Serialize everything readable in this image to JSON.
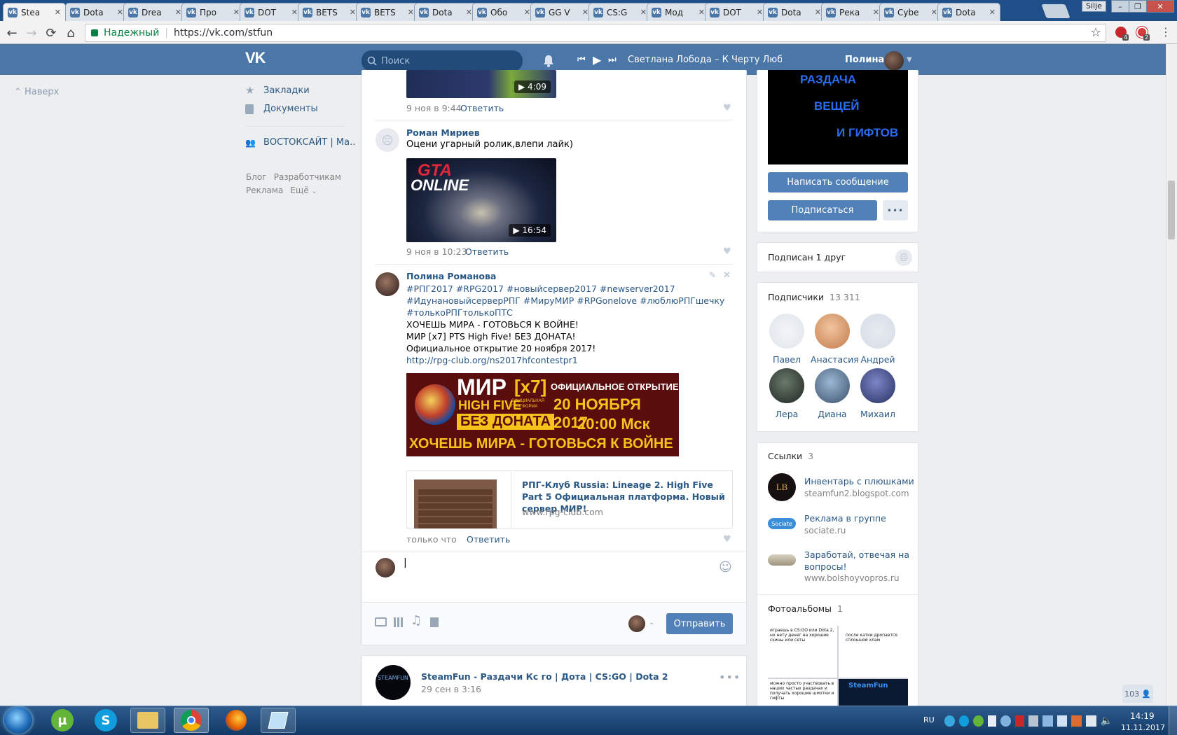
{
  "browser": {
    "tabs": [
      {
        "label": "Stea"
      },
      {
        "label": "Dota"
      },
      {
        "label": "Drea"
      },
      {
        "label": "Про"
      },
      {
        "label": "DOT"
      },
      {
        "label": "BETS"
      },
      {
        "label": "BETS"
      },
      {
        "label": "Dota"
      },
      {
        "label": "Обо"
      },
      {
        "label": "GG V"
      },
      {
        "label": "CS:G"
      },
      {
        "label": "Мод"
      },
      {
        "label": "DOT"
      },
      {
        "label": "Dota"
      },
      {
        "label": "Река"
      },
      {
        "label": "Cybe"
      },
      {
        "label": "Dota"
      }
    ],
    "tab_close": "✕",
    "profile_label": "Silje",
    "secure_label": "Надежный",
    "url": "https://vk.com/stfun",
    "ext_badges": [
      "4",
      "2"
    ]
  },
  "vk_header": {
    "logo": "VK",
    "search_placeholder": "Поиск",
    "now_playing": "Светлана Лобода – К Черту Любо...",
    "user_name": "Полина"
  },
  "left_nav": {
    "back_to_top": "Наверх",
    "items": [
      {
        "label": "Закладки"
      },
      {
        "label": "Документы"
      },
      {
        "label": "ВОСТОКСАЙТ | Ма.."
      }
    ],
    "footer_links": [
      {
        "label": "Блог"
      },
      {
        "label": "Разработчикам"
      },
      {
        "label": "Реклама"
      },
      {
        "label": "Ещё"
      }
    ]
  },
  "feed": {
    "top_comment": {
      "duration": "4:09",
      "date": "9 ноя в 9:44",
      "reply": "Ответить"
    },
    "comment_roman": {
      "author": "Роман Мириев",
      "text": "Оцени угарный ролик,влепи лайк)",
      "video_title_line1": "GTA",
      "video_title_line2": "ONLINE",
      "duration": "16:54",
      "date": "9 ноя в 10:23",
      "reply": "Ответить"
    },
    "comment_polina": {
      "author": "Полина Романова",
      "hashtags_1": "#РПГ2017 #RPG2017 #новыйсервер2017 #newserver2017",
      "hashtags_2": "#ИдунановыйсерверРПГ #МируМИР #RPGonelove #люблюРПГшечку",
      "hashtags_3": "#толькоРПГтолькоПТС",
      "line_1": "ХОЧЕШЬ МИРА - ГОТОВЬСЯ К ВОЙНЕ!",
      "line_2": "МИР [x7] PTS High Five! БЕЗ ДОНАТА!",
      "line_3": "Официальное открытие 20 ноября 2017!",
      "link": "http://rpg-club.org/ns2017hfcontestpr1",
      "banner": {
        "title": "МИР",
        "x7": "[x7]",
        "subtitle": "HIGH FIVE",
        "platform": "ОФИЦИАЛЬНАЯ ПЛАТФОРМА",
        "no_donate": "БЕЗ ДОНАТА",
        "official_open": "ОФИЦИАЛЬНОЕ ОТКРЫТИЕ",
        "date": "20 НОЯБРЯ 2017",
        "time": "20:00 Мск",
        "slogan": "ХОЧЕШЬ МИРА - ГОТОВЬСЯ К ВОЙНЕ"
      },
      "snippet_title": "РПГ-Клуб Russia: Lineage 2. High Five Part 5 Официальная платформа. Новый сервер МИР!",
      "snippet_domain": "www.rpg-club.com",
      "date": "только что",
      "reply": "Ответить"
    },
    "composer": {
      "send_label": "Отправить"
    },
    "next_post": {
      "author": "SteamFun - Раздачи Кс го | Дота | CS:GO | Dota 2",
      "date": "29 сен в 3:16",
      "avatar_text": "STEAMFUN"
    }
  },
  "right": {
    "cover_lines": [
      "РАЗДАЧА",
      "ВЕЩЕЙ",
      "И ГИФТОВ"
    ],
    "write_message": "Написать сообщение",
    "subscribe": "Подписаться",
    "friend_sub": "Подписан 1 друг",
    "subscribers_label": "Подписчики",
    "subscribers_count": "13 311",
    "subscribers": [
      {
        "name": "Павел"
      },
      {
        "name": "Анастасия"
      },
      {
        "name": "Андрей"
      },
      {
        "name": "Лера"
      },
      {
        "name": "Диана"
      },
      {
        "name": "Михаил"
      }
    ],
    "links_label": "Ссылки",
    "links_count": "3",
    "links": [
      {
        "title": "Инвентарь с плюшками",
        "domain": "steamfun2.blogspot.com",
        "icon_text": "LB"
      },
      {
        "title": "Реклама в группе",
        "domain": "sociate.ru",
        "icon_text": "Sociate"
      },
      {
        "title": "Заработай, отвечая на вопросы!",
        "domain": "www.bolshoyvopros.ru",
        "icon_text": ""
      }
    ],
    "albums_label": "Фотоальбомы",
    "albums_count": "1",
    "album_captions": [
      "играешь в CS:GO или Dota 2, но нету денег на хорошие скины или сеты",
      "после катки дропается сплошной хлам",
      "можно просто участвовать в наших частых раздачах и получать хорошие шмотки и гифты",
      "SteamFun"
    ],
    "online_count": "103"
  },
  "taskbar": {
    "lang": "RU",
    "time": "14:19",
    "date": "11.11.2017"
  },
  "colors": {
    "vk_blue": "#4a76a8",
    "link": "#2a5885",
    "button": "#5181b8",
    "page_bg": "#edeef0"
  }
}
